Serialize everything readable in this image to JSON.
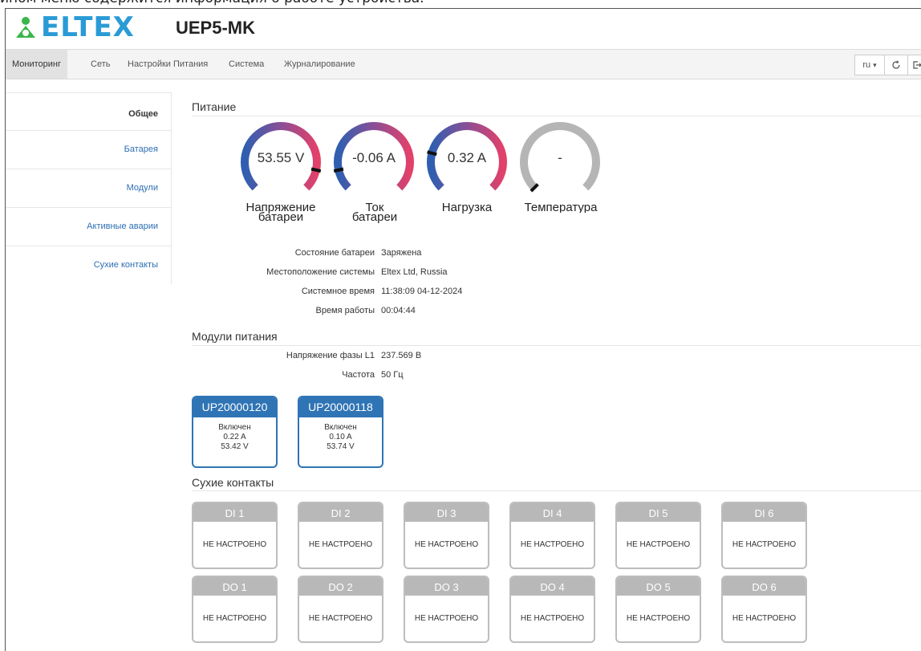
{
  "doc": {
    "caption_fragment": "ином меню содержится информация о работе устройства."
  },
  "header": {
    "logo": "ELTEX",
    "device": "UEP5-MK"
  },
  "nav": {
    "items": [
      "Мониторинг",
      "Сеть",
      "Настройки Питания",
      "Система",
      "Журналирование"
    ],
    "lang": "ru",
    "lang_caret": "▾",
    "refresh_icon": "refresh-icon",
    "logout_icon": "logout-icon"
  },
  "sidebar": {
    "items": [
      "Общее",
      "Батарея",
      "Модули",
      "Активные аварии",
      "Сухие контакты"
    ]
  },
  "power": {
    "title": "Питание",
    "gauges": [
      {
        "value": "53.55 V",
        "label1": "Напряжение",
        "label2": "батареи",
        "level": 0.88,
        "colored": true
      },
      {
        "value": "-0.06 A",
        "label1": "Ток",
        "label2": "батареи",
        "level": 0.12,
        "colored": true
      },
      {
        "value": "0.32 A",
        "label1": "Нагрузка",
        "label2": "",
        "level": 0.22,
        "colored": true
      },
      {
        "value": "-",
        "label1": "Температура",
        "label2": "",
        "level": 0.0,
        "colored": false
      }
    ],
    "colors": {
      "low": "#2e5fb0",
      "mid": "#8a4f96",
      "high": "#e2416a",
      "empty": "#b5b5b5"
    },
    "info": [
      {
        "k": "Состояние батареи",
        "v": "Заряжена"
      },
      {
        "k": "Местоположение системы",
        "v": "Eltex Ltd, Russia"
      },
      {
        "k": "Системное время",
        "v": "11:38:09 04-12-2024"
      },
      {
        "k": "Время работы",
        "v": "00:04:44"
      }
    ]
  },
  "modules": {
    "title": "Модули питания",
    "info": [
      {
        "k": "Напряжение фазы L1",
        "v": "237.569 В"
      },
      {
        "k": "Частота",
        "v": "50 Гц"
      }
    ],
    "units": [
      {
        "id": "UP20000120",
        "state": "Включен",
        "current": "0.22 A",
        "voltage": "53.42 V"
      },
      {
        "id": "UP20000118",
        "state": "Включен",
        "current": "0.10 A",
        "voltage": "53.74 V"
      }
    ]
  },
  "contacts": {
    "title": "Сухие контакты",
    "di": [
      {
        "name": "DI 1",
        "status": "НЕ НАСТРОЕНО"
      },
      {
        "name": "DI 2",
        "status": "НЕ НАСТРОЕНО"
      },
      {
        "name": "DI 3",
        "status": "НЕ НАСТРОЕНО"
      },
      {
        "name": "DI 4",
        "status": "НЕ НАСТРОЕНО"
      },
      {
        "name": "DI 5",
        "status": "НЕ НАСТРОЕНО"
      },
      {
        "name": "DI 6",
        "status": "НЕ НАСТРОЕНО"
      }
    ],
    "do": [
      {
        "name": "DO 1",
        "status": "НЕ НАСТРОЕНО"
      },
      {
        "name": "DO 2",
        "status": "НЕ НАСТРОЕНО"
      },
      {
        "name": "DO 3",
        "status": "НЕ НАСТРОЕНО"
      },
      {
        "name": "DO 4",
        "status": "НЕ НАСТРОЕНО"
      },
      {
        "name": "DO 5",
        "status": "НЕ НАСТРОЕНО"
      },
      {
        "name": "DO 6",
        "status": "НЕ НАСТРОЕНО"
      }
    ]
  }
}
